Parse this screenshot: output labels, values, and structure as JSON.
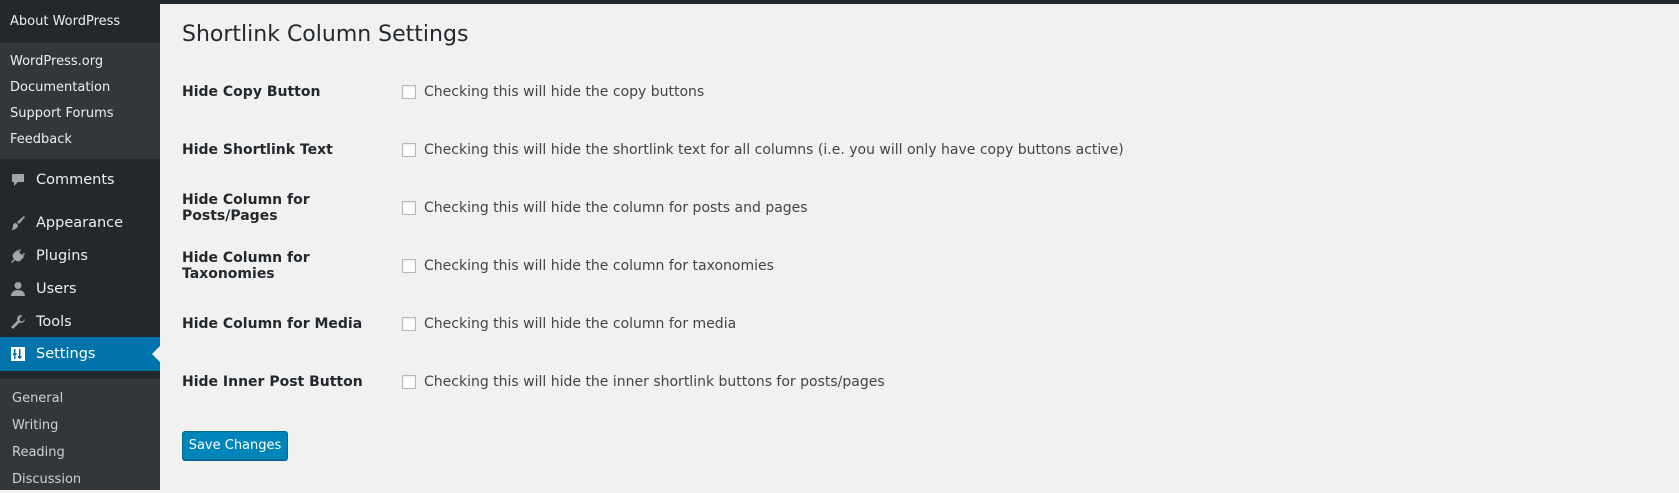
{
  "sidebar": {
    "about": "About WordPress",
    "wp_links": [
      "WordPress.org",
      "Documentation",
      "Support Forums",
      "Feedback"
    ],
    "menu": {
      "comments": "Comments",
      "appearance": "Appearance",
      "plugins": "Plugins",
      "users": "Users",
      "tools": "Tools",
      "settings": "Settings"
    },
    "settings_sub": [
      "General",
      "Writing",
      "Reading",
      "Discussion"
    ]
  },
  "page": {
    "title": "Shortlink Column Settings",
    "rows": [
      {
        "label": "Hide Copy Button",
        "description": "Checking this will hide the copy buttons"
      },
      {
        "label": "Hide Shortlink Text",
        "description": "Checking this will hide the shortlink text for all columns (i.e. you will only have copy buttons active)"
      },
      {
        "label": "Hide Column for Posts/Pages",
        "description": "Checking this will hide the column for posts and pages"
      },
      {
        "label": "Hide Column for Taxonomies",
        "description": "Checking this will hide the column for taxonomies"
      },
      {
        "label": "Hide Column for Media",
        "description": "Checking this will hide the column for media"
      },
      {
        "label": "Hide Inner Post Button",
        "description": "Checking this will hide the inner shortlink buttons for posts/pages"
      }
    ],
    "save_label": "Save Changes"
  },
  "colors": {
    "sidebar_bg": "#23282d",
    "submenu_bg": "#32373c",
    "accent": "#0073aa",
    "button": "#0085ba",
    "content_bg": "#f1f1f1"
  },
  "icons": [
    "comment-icon",
    "paintbrush-icon",
    "plugin-icon",
    "user-icon",
    "wrench-icon",
    "settings-icon"
  ]
}
